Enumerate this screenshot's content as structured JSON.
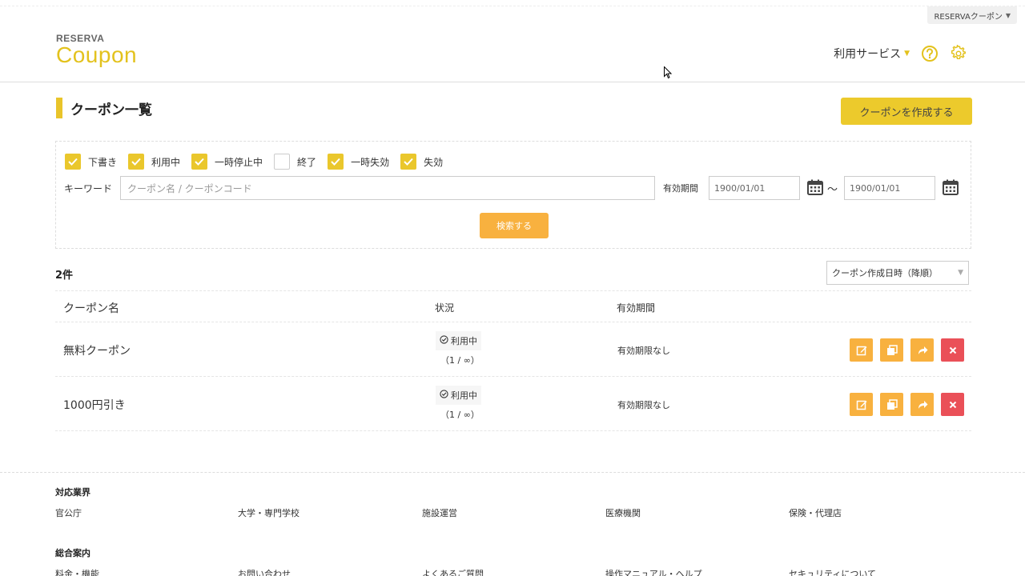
{
  "account": {
    "label": "RESERVAクーポン"
  },
  "logo": {
    "top": "RESERVA",
    "bottom": "Coupon"
  },
  "header": {
    "service_menu": "利用サービス"
  },
  "page": {
    "title": "クーポン一覧",
    "create_button": "クーポンを作成する"
  },
  "filters": {
    "statuses": [
      {
        "label": "下書き",
        "checked": true
      },
      {
        "label": "利用中",
        "checked": true
      },
      {
        "label": "一時停止中",
        "checked": true
      },
      {
        "label": "終了",
        "checked": false
      },
      {
        "label": "一時失効",
        "checked": true
      },
      {
        "label": "失効",
        "checked": true
      }
    ],
    "keyword_label": "キーワード",
    "keyword_placeholder": "クーポン名 / クーポンコード",
    "period_label": "有効期間",
    "date_from": "1900/01/01",
    "date_separator": "～",
    "date_to": "1900/01/01",
    "search_button": "検索する"
  },
  "results": {
    "count": "2件",
    "sort": "クーポン作成日時（降順）",
    "columns": {
      "name": "クーポン名",
      "status": "状況",
      "period": "有効期間"
    },
    "rows": [
      {
        "name": "無料クーポン",
        "status": "利用中",
        "usage": "（1 / ∞）",
        "period": "有効期限なし"
      },
      {
        "name": "1000円引き",
        "status": "利用中",
        "usage": "（1 / ∞）",
        "period": "有効期限なし"
      }
    ]
  },
  "footer": {
    "industries_heading": "対応業界",
    "industries": [
      "官公庁",
      "大学・専門学校",
      "施設運営",
      "医療機関",
      "保険・代理店"
    ],
    "guide_heading": "総合案内",
    "guide": [
      "料金・機能",
      "お問い合わせ",
      "よくあるご質問",
      "操作マニュアル・ヘルプ",
      "セキュリティについて"
    ]
  },
  "colors": {
    "brand_yellow": "#e3c21d",
    "checkbox": "#eac72c",
    "action_orange": "#f8b13f",
    "action_red": "#ea5058"
  }
}
